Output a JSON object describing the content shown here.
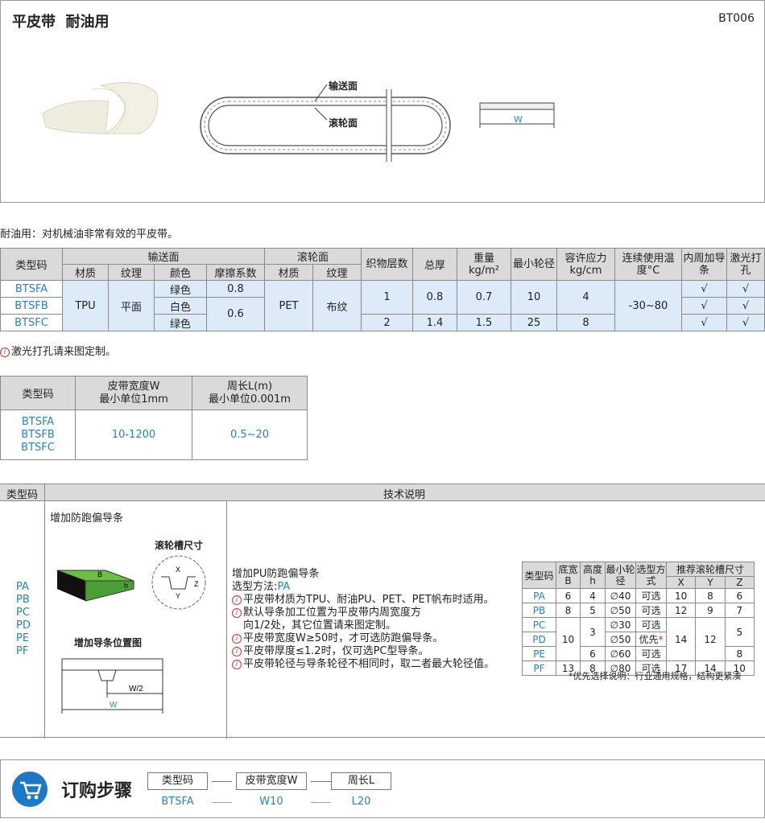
{
  "header": {
    "title": "平皮带",
    "subtitle": "耐油用",
    "code": "BT006"
  },
  "diagram": {
    "label_conveying": "输送面",
    "label_roller": "滚轮面",
    "label_w": "W"
  },
  "description": "耐油用：对机械油非常有效的平皮带。",
  "spec_table": {
    "h_type": "类型码",
    "h_conveying": "输送面",
    "h_roller": "滚轮面",
    "h_material": "材质",
    "h_texture": "纹理",
    "h_color": "颜色",
    "h_friction": "摩擦系数",
    "h_r_material": "材质",
    "h_r_texture": "纹理",
    "h_layers": "织物层数",
    "h_thick": "总厚",
    "h_weight": "重量",
    "h_weight_unit": "kg/m²",
    "h_minwheel": "最小轮径",
    "h_stress": "容许应力",
    "h_stress_unit": "kg/cm",
    "h_temp": "连续使用温度°C",
    "h_guide": "内周加导条",
    "h_laser": "激光打孔",
    "rows": [
      {
        "code": "BTSFA",
        "material": "TPU",
        "texture": "平面",
        "color": "绿色",
        "friction": "0.8",
        "r_material": "PET",
        "r_texture": "布纹",
        "layers": "1",
        "thick": "0.8",
        "weight": "0.7",
        "minwheel": "10",
        "stress": "4",
        "temp": "-30~80",
        "guide": "√",
        "laser": "√"
      },
      {
        "code": "BTSFB",
        "color": "白色",
        "friction": "0.6",
        "guide": "√",
        "laser": "√"
      },
      {
        "code": "BTSFC",
        "color": "绿色",
        "layers": "2",
        "thick": "1.4",
        "weight": "1.5",
        "minwheel": "25",
        "stress": "8",
        "guide": "√",
        "laser": "√"
      }
    ]
  },
  "laser_note": "激光打孔请来图定制。",
  "size_table": {
    "h_type": "类型码",
    "h_width": "皮带宽度W",
    "h_width_sub": "最小单位1mm",
    "h_length": "周长L(m)",
    "h_length_sub": "最小单位0.001m",
    "codes": [
      "BTSFA",
      "BTSFB",
      "BTSFC"
    ],
    "width": "10-1200",
    "length": "0.5~20"
  },
  "tech": {
    "h_type": "类型码",
    "h_desc": "技术说明",
    "codes": [
      "PA",
      "PB",
      "PC",
      "PD",
      "PE",
      "PF"
    ],
    "guide_title": "增加防跑偏导条",
    "groove_title": "滚轮槽尺寸",
    "position_title": "增加导条位置图",
    "dim_b": "B",
    "dim_h": "h",
    "dim_x": "X",
    "dim_y": "Y",
    "dim_z": "Z",
    "dim_w2": "W/2",
    "dim_w": "W",
    "notes_title": "增加PU防跑偏导条",
    "method_label": "选型方法:",
    "method_value": "PA",
    "notes": [
      "平皮带材质为TPU、耐油PU、PET、PET帆布时适用。",
      "默认导条加工位置为平皮带内周宽度方",
      "向1/2处，其它位置请来图定制。",
      "平皮带宽度W≥50时，才可选防跑偏导条。",
      "平皮带厚度≤1.2时，仅可选PC型导条。",
      "平皮带轮径与导条轮径不相同时，取二者最大轮径值。"
    ],
    "guide_table": {
      "h_type": "类型码",
      "h_base": "底宽",
      "h_base_sub": "B",
      "h_height": "高度",
      "h_height_sub": "h",
      "h_min": "最小轮径",
      "h_sel": "选型方式",
      "h_groove": "推荐滚轮槽尺寸",
      "h_x": "X",
      "h_y": "Y",
      "h_z": "Z",
      "rows": [
        {
          "code": "PA",
          "b": "6",
          "h": "4",
          "min": "∅40",
          "sel": "可选",
          "x": "10",
          "y": "8",
          "z": "6"
        },
        {
          "code": "PB",
          "b": "8",
          "h": "5",
          "min": "∅50",
          "sel": "可选",
          "x": "12",
          "y": "9",
          "z": "7"
        },
        {
          "code": "PC",
          "b": "10",
          "h": "3",
          "min": "∅30",
          "sel": "可选",
          "x": "14",
          "y": "12",
          "z": "5"
        },
        {
          "code": "PD",
          "min": "∅50",
          "sel": "优先"
        },
        {
          "code": "PE",
          "h": "6",
          "min": "∅60",
          "sel": "可选",
          "z": "8"
        },
        {
          "code": "PF",
          "b": "13",
          "h": "8",
          "min": "∅80",
          "sel": "可选",
          "x": "17",
          "y": "14",
          "z": "10"
        }
      ],
      "footnote": "*优先选择说明：行业通用规格，结构更紧凑"
    }
  },
  "order": {
    "title": "订购步骤",
    "steps": [
      "类型码",
      "皮带宽度W",
      "周长L"
    ],
    "examples": [
      "BTSFA",
      "W10",
      "L20"
    ]
  }
}
